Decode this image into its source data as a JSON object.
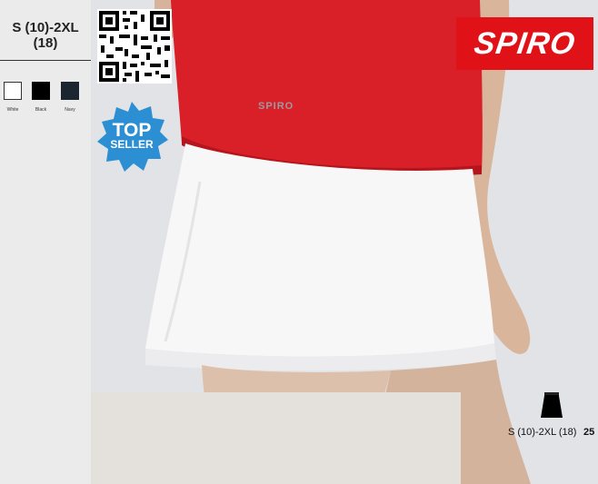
{
  "size_range": {
    "line1": "S (10)-2XL",
    "line2": "(18)"
  },
  "colours": [
    {
      "name": "White",
      "hex": "#ffffff"
    },
    {
      "name": "Black",
      "hex": "#000000"
    },
    {
      "name": "Navy",
      "hex": "#1c2630"
    }
  ],
  "brand": {
    "logo_text": "SPIRO",
    "shirt_print": "SPIRO",
    "logo_color": "#e01218"
  },
  "badge": {
    "line1": "TOP",
    "line2": "SELLER",
    "color": "#2d8fd3"
  },
  "footer": {
    "size_caption": "S (10)-2XL (18)",
    "page_number": "25",
    "product_icon": "skirt-icon"
  },
  "qr_icon": "qr-code-icon"
}
